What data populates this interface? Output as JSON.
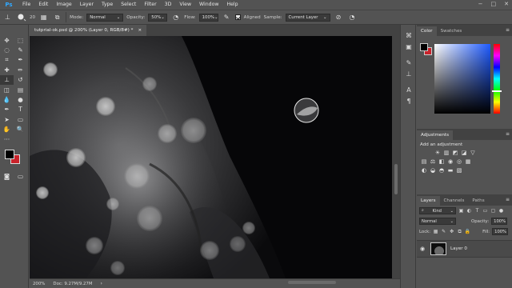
{
  "app": {
    "logo": "Ps"
  },
  "menu": [
    "File",
    "Edit",
    "Image",
    "Layer",
    "Type",
    "Select",
    "Filter",
    "3D",
    "View",
    "Window",
    "Help"
  ],
  "window_controls": [
    "−",
    "□",
    "✕"
  ],
  "options": {
    "brush_size": "20",
    "mode_label": "Mode:",
    "mode_value": "Normal",
    "opacity_label": "Opacity:",
    "opacity_value": "50%",
    "flow_label": "Flow:",
    "flow_value": "100%",
    "aligned_label": "Aligned",
    "sample_label": "Sample:",
    "sample_value": "Current Layer"
  },
  "document": {
    "tab_title": "tutprial-ok.psd @ 200% (Layer 0, RGB/8#) *",
    "close_glyph": "×",
    "zoom": "200%",
    "doc_info": "Doc: 9.27M/9.27M"
  },
  "color_panel": {
    "tabs": [
      "Color",
      "Swatches"
    ],
    "fg_color": "#000000",
    "bg_color": "#c9232b"
  },
  "adjustments": {
    "tab": "Adjustments",
    "title": "Add an adjustment"
  },
  "layers": {
    "tabs": [
      "Layers",
      "Channels",
      "Paths"
    ],
    "kind_label": "Kind",
    "blend_mode": "Normal",
    "opacity_label": "Opacity:",
    "opacity_value": "100%",
    "lock_label": "Lock:",
    "fill_label": "Fill:",
    "fill_value": "100%",
    "layer_name": "Layer 0"
  }
}
